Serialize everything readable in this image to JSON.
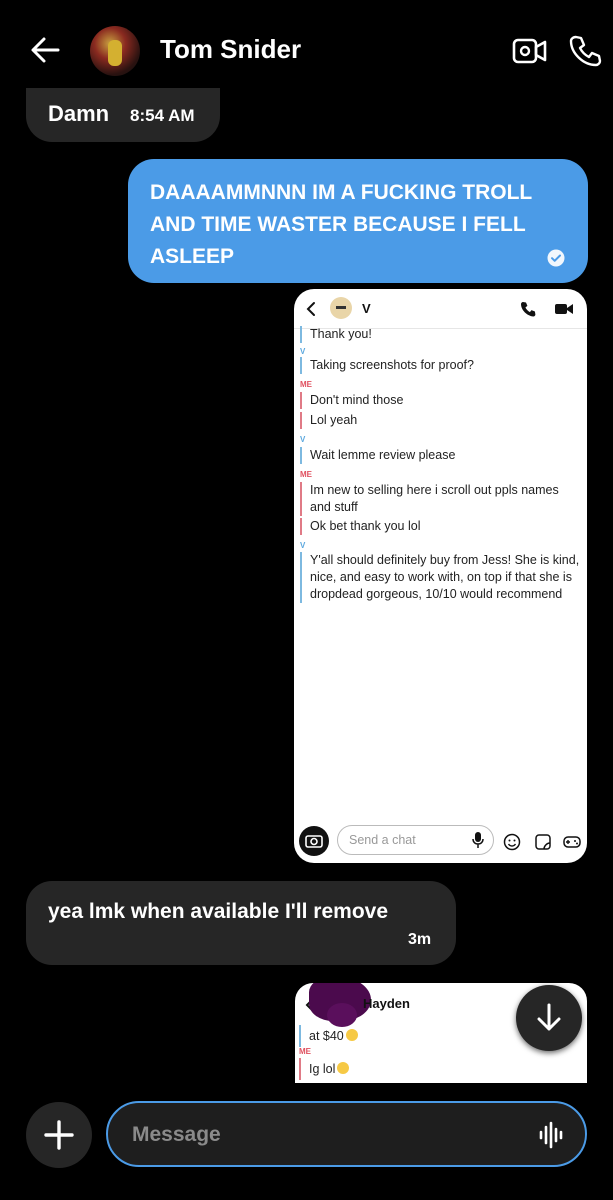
{
  "header": {
    "back_icon": "arrow-left-icon",
    "contact_name": "Tom Snider",
    "video_icon": "video-camera-icon",
    "call_icon": "phone-icon"
  },
  "messages": [
    {
      "direction": "incoming",
      "text": "Damn",
      "time": "8:54 AM"
    },
    {
      "direction": "outgoing",
      "text": "DAAAAMMNNN IM A FUCKING TROLL AND TIME WASTER BECAUSE I FELL ASLEEP",
      "status_icon": "read-check-icon"
    },
    {
      "direction": "incoming",
      "text": "yea lmk when available I'll remove",
      "time": "3m"
    }
  ],
  "attachment1": {
    "contact": "V",
    "lines": [
      {
        "label": "",
        "sender": "v",
        "text": "Thank you!"
      },
      {
        "label": "V",
        "sender": "v",
        "text": "Taking screenshots for proof?"
      },
      {
        "label": "ME",
        "sender": "me",
        "text": "Don't mind those"
      },
      {
        "label": "",
        "sender": "me",
        "text": "Lol yeah"
      },
      {
        "label": "V",
        "sender": "v",
        "text": "Wait lemme review please"
      },
      {
        "label": "ME",
        "sender": "me",
        "text": "Im new to selling here i scroll out ppls names and stuff"
      },
      {
        "label": "",
        "sender": "me",
        "text": "Ok bet thank you lol"
      },
      {
        "label": "V",
        "sender": "v",
        "text": "Y'all should definitely buy from Jess! She is kind, nice, and easy to work with, on top if that she is dropdead gorgeous, 10/10 would recommend"
      }
    ],
    "chat_placeholder": "Send a chat"
  },
  "attachment2": {
    "contact": "Hayden",
    "line1": "at $40",
    "label": "ME",
    "line2": "Ig lol"
  },
  "composer": {
    "placeholder": "Message",
    "add_icon": "plus-icon",
    "voice_icon": "waveform-icon"
  },
  "colors": {
    "outgoing_bubble": "#4b9be7",
    "incoming_bubble": "#262626",
    "background": "#000000"
  }
}
